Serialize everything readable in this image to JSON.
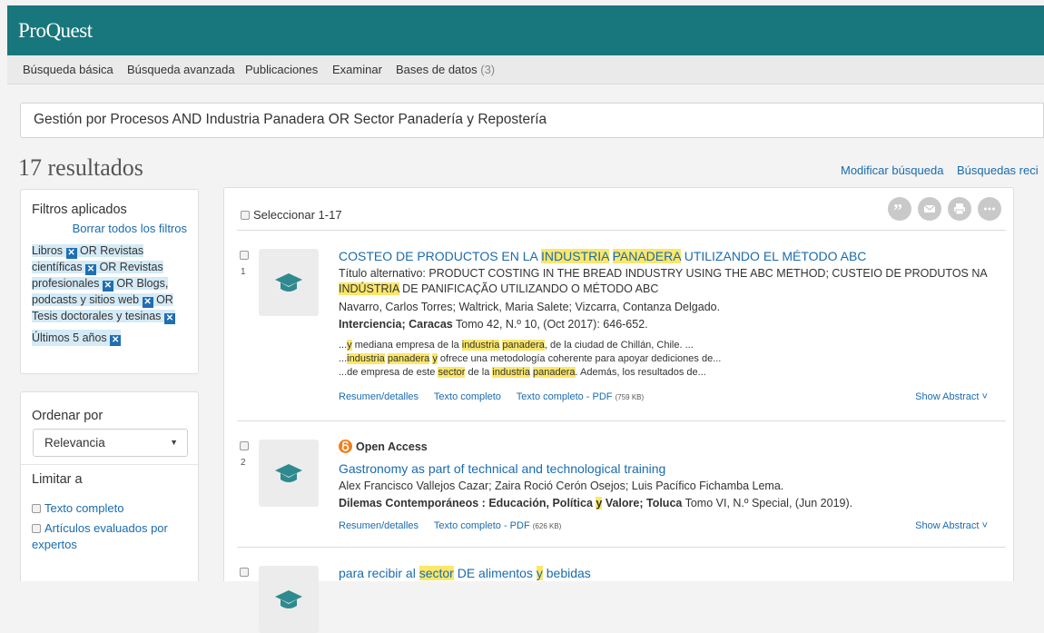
{
  "app": {
    "name": "ProQuest"
  },
  "nav": {
    "items": [
      "Búsqueda básica",
      "Búsqueda avanzada",
      "Publicaciones",
      "Examinar",
      "Bases de datos"
    ],
    "db_count": "(3)"
  },
  "search": {
    "query": "Gestión por Procesos AND  Industria Panadera OR Sector Panadería y Repostería"
  },
  "results_header": {
    "count": "17 resultados",
    "modify": "Modificar búsqueda",
    "recent": "Búsquedas reci"
  },
  "filters": {
    "title": "Filtros aplicados",
    "clear": "Borrar todos los filtros",
    "chips": [
      "Libros",
      "OR Revistas científicas",
      "OR Revistas profesionales",
      "OR Blogs, podcasts y sitios web",
      "OR Tesis doctorales y tesinas",
      "Últimos 5 años"
    ]
  },
  "sort": {
    "title": "Ordenar por",
    "selected": "Relevancia",
    "limit_title": "Limitar a",
    "options": [
      "Texto completo",
      "Artículos evaluados por expertos"
    ]
  },
  "toolbar": {
    "select_all": "Seleccionar 1-17",
    "icons": [
      "quote-icon",
      "email-icon",
      "print-icon",
      "more-icon"
    ]
  },
  "results": [
    {
      "num": "1",
      "title": {
        "pre": "COSTEO DE PRODUCTOS EN LA ",
        "hl1": "INDUSTRIA",
        "mid": " ",
        "hl2": "PANADERA",
        "post": " UTILIZANDO EL MÉTODO ABC"
      },
      "alt_title": {
        "pre": "Título alternativo: PRODUCT COSTING IN THE BREAD INDUSTRY USING THE ABC METHOD; CUSTEIO DE PRODUTOS NA",
        "hl": "INDÚSTRIA",
        "post": " DE PANIFICAÇÃO UTILIZANDO O MÉTODO ABC"
      },
      "authors": "Navarro, Carlos Torres; Waltrick, Maria Salete; Vizcarra, Contanza Delgado.",
      "source": {
        "bold": "Interciencia; Caracas",
        "rest": " Tomo 42, N.º 10,  (Oct 2017): 646-652."
      },
      "snippets": [
        {
          "a": "...",
          "h1": "y",
          "b": " mediana empresa de la ",
          "h2": "industria",
          "c": " ",
          "h3": "panadera",
          "d": ", de la ciudad de Chillán, Chile. ..."
        },
        {
          "a": "...",
          "h1": "industria",
          "b": " ",
          "h2": "panadera",
          "c": " ",
          "h3": "y",
          "d": " ofrece una metodología coherente para apoyar dediciones de..."
        },
        {
          "a": "...de empresa de este ",
          "h1": "sector",
          "b": " de la ",
          "h2": "industria",
          "c": " ",
          "h3": "panadera",
          "d": ". Además, los resultados de..."
        }
      ],
      "links": [
        "Resumen/detalles",
        "Texto completo",
        "Texto completo - PDF"
      ],
      "pdf_size": "(759 KB)",
      "show_abstract": "Show Abstract"
    },
    {
      "num": "2",
      "badge": "Open Access",
      "title": "Gastronomy as part of technical and technological training",
      "authors": "Alex Francisco Vallejos Cazar; Zaira Roció Cerón Osejos; Luis Pacífico Fichamba Lema.",
      "source": {
        "bold_a": "Dilemas Contemporáneos : Educación, Política ",
        "hl": "y",
        "bold_b": " Valore; Toluca",
        "rest": " Tomo VI, N.º Special,  (Jun 2019)."
      },
      "links": [
        "Resumen/detalles",
        "Texto completo - PDF"
      ],
      "pdf_size": "(626 KB)",
      "show_abstract": "Show Abstract"
    },
    {
      "num": "",
      "title": {
        "pre": "para recibir al ",
        "hl1": "sector",
        "mid": " DE alimentos ",
        "hl2": "y",
        "post": " bebidas"
      }
    }
  ]
}
